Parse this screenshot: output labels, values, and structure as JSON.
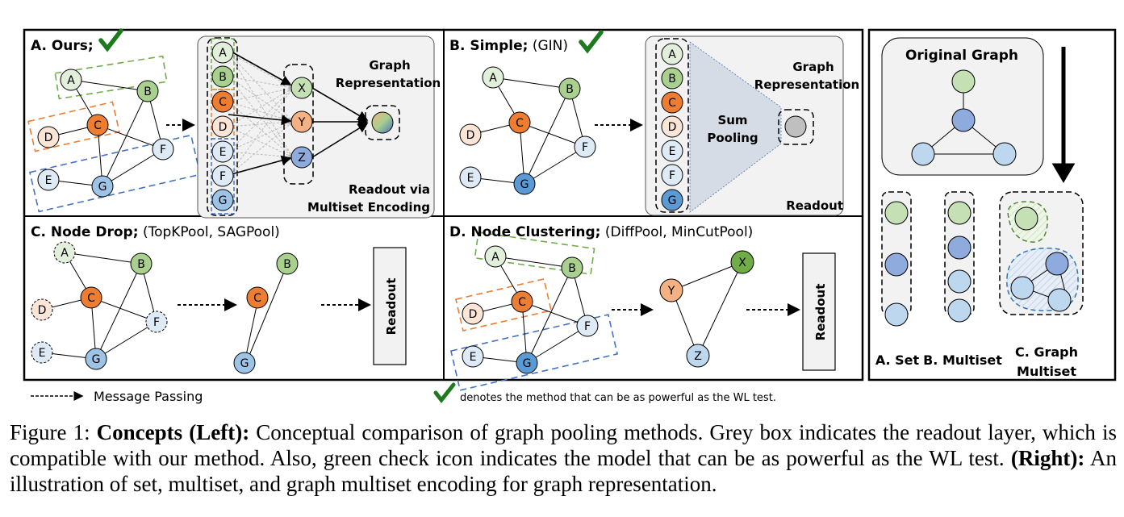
{
  "panels": {
    "a": {
      "title": "A. Ours;",
      "readout_title": "Graph Representation",
      "readout_caption_1": "Readout via",
      "readout_caption_2": "Multiset Encoding",
      "check": true
    },
    "b": {
      "title_bold": "B. Simple;",
      "title_methods": "(GIN)",
      "sum_pooling_1": "Sum",
      "sum_pooling_2": "Pooling",
      "readout_title": "Graph Representation",
      "readout_label": "Readout",
      "check": true
    },
    "c": {
      "title_bold": "C. Node Drop;",
      "title_methods": "(TopKPool, SAGPool)",
      "readout_label": "Readout"
    },
    "d": {
      "title_bold": "D. Node Clustering;",
      "title_methods": "(DiffPool, MinCutPool)",
      "readout_label": "Readout"
    },
    "right": {
      "original_title": "Original Graph",
      "label_set": "A. Set",
      "label_multiset": "B. Multiset",
      "label_graph_multiset_1": "C. Graph",
      "label_graph_multiset_2": "Multiset"
    }
  },
  "nodes": [
    "A",
    "B",
    "C",
    "D",
    "E",
    "F",
    "G"
  ],
  "pooled_nodes": [
    "X",
    "Y",
    "Z"
  ],
  "legend": {
    "message_passing": "Message Passing",
    "check_note": "denotes the method that can be as powerful as the WL test."
  },
  "caption": {
    "prefix": "Figure 1: ",
    "bold1": "Concepts (Left):",
    "text1": " Conceptual comparison of graph pooling methods. Grey box indicates the readout layer, which is compatible with our method. Also, green check icon indicates the model that can be as powerful as the WL test. ",
    "bold2": "(Right):",
    "text2": " An illustration of set, multiset, and graph multiset encoding for graph representation."
  },
  "colors": {
    "A": "#e2efda",
    "B": "#a9d08e",
    "C": "#ed7d31",
    "D": "#fbe5d6",
    "E": "#deebf7",
    "F": "#deebf7",
    "G": "#9dc3e6",
    "G_dark": "#5b9bd5",
    "X": "#c5e0b4",
    "Y": "#f4b183",
    "Z": "#8faadc",
    "X_dark": "#70ad47",
    "Z_light": "#bdd7ee",
    "check": "#1e7a1e",
    "green_box": "#70ad47",
    "orange_box": "#ed7d31",
    "blue_box": "#4472c4",
    "grey_panel": "#f2f2f2"
  }
}
